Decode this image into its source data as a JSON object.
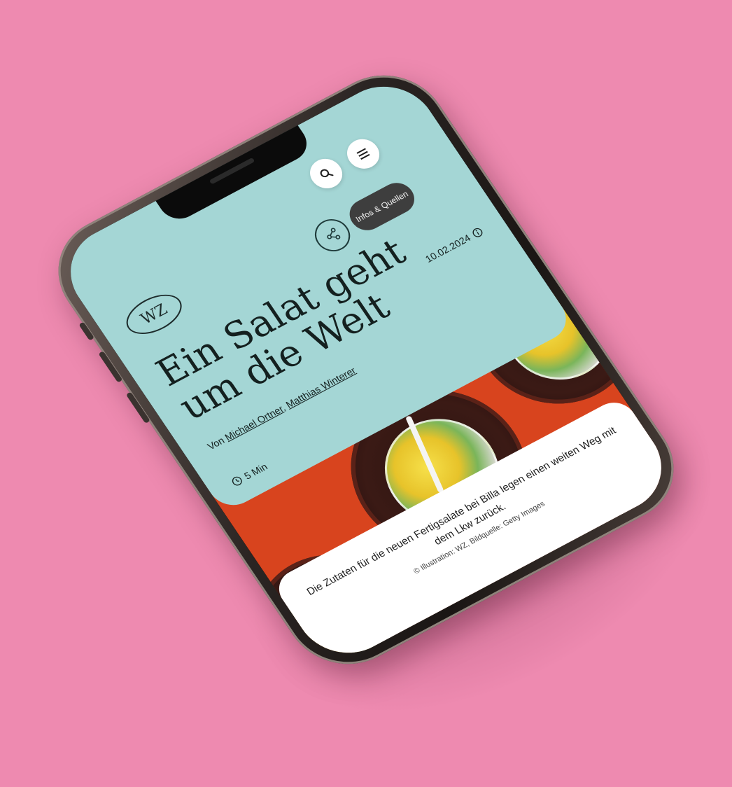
{
  "header": {
    "logo": "WZ",
    "infos_button": "Infos & Quellen"
  },
  "icons": {
    "search": "search-icon",
    "menu": "hamburger-menu-icon",
    "share": "share-icon",
    "info": "info-icon",
    "clock": "clock-icon"
  },
  "article": {
    "title": "Ein Salat geht um die Welt",
    "date": "10.02.2024",
    "byline_prefix": "Von",
    "authors": [
      "Michael Ortner",
      "Matthias Winterer"
    ],
    "author_separator": ",",
    "read_time": "5 Min"
  },
  "hero": {
    "caption": "Die Zutaten für die neuen Fertigsalate bei Billa legen einen weiten Weg mit dem Lkw zurück.",
    "credit": "© Illustration: WZ, Bildquelle: Getty Images"
  },
  "colors": {
    "background": "#ee8ab0",
    "panel": "#a4d6d5",
    "hero": "#d8441e",
    "text": "#14201f"
  }
}
